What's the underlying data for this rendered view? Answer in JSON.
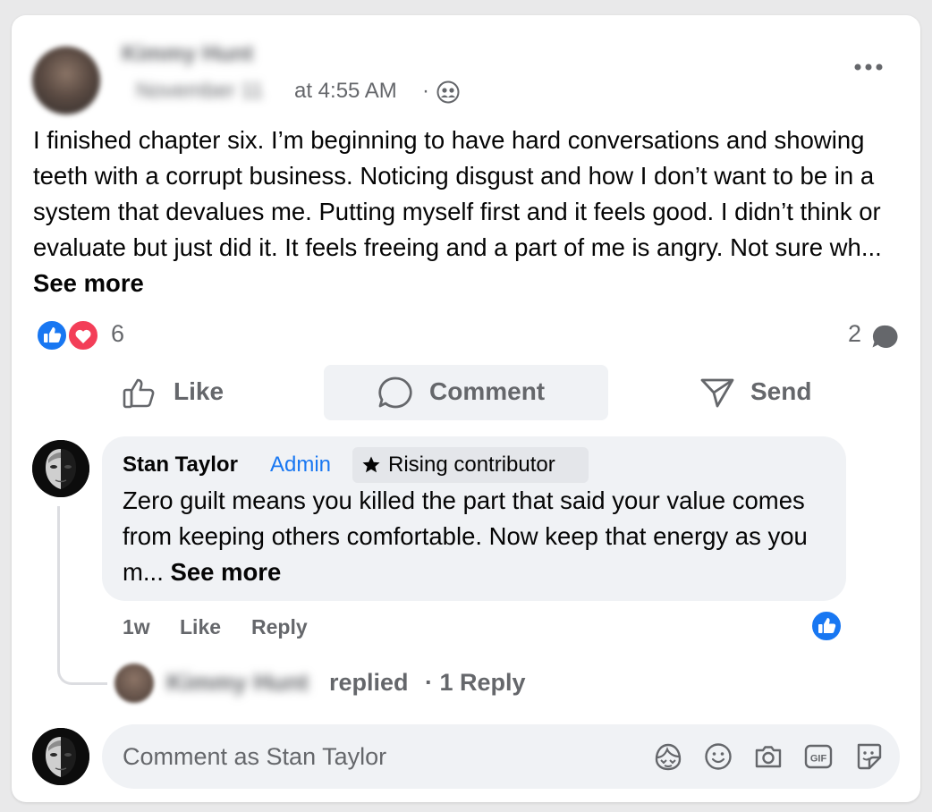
{
  "post": {
    "author_name": "Kimmy Hunt",
    "date": "November 11",
    "time": "at 4:55 AM",
    "separator": "·",
    "body": "I finished chapter six. I’m beginning to have hard conversations and showing teeth with a corrupt business. Noticing disgust and how I don’t want to be in a system that devalues me. Putting myself first and it feels good. I didn’t think or evaluate but just did it. It feels freeing and a part of me is angry. Not sure wh...",
    "see_more": "See more"
  },
  "stats": {
    "reaction_count": "6",
    "comment_count": "2"
  },
  "actions": {
    "like": "Like",
    "comment": "Comment",
    "send": "Send"
  },
  "comment": {
    "author": "Stan Taylor",
    "admin_badge": "Admin",
    "contributor_badge": "Rising contributor",
    "text": "Zero guilt means you killed the part that said your value comes from keeping others comfortable. Now keep that energy as you m...",
    "see_more": "See more",
    "time": "1w",
    "like": "Like",
    "reply": "Reply"
  },
  "reply_summary": {
    "name": "Kimmy Hunt",
    "action": "replied",
    "count": "· 1 Reply"
  },
  "composer": {
    "placeholder": "Comment as Stan Taylor"
  },
  "colors": {
    "accent": "#1877f2",
    "love": "#f33e58",
    "secondary_text": "#65676b",
    "bubble": "#f0f2f5"
  }
}
